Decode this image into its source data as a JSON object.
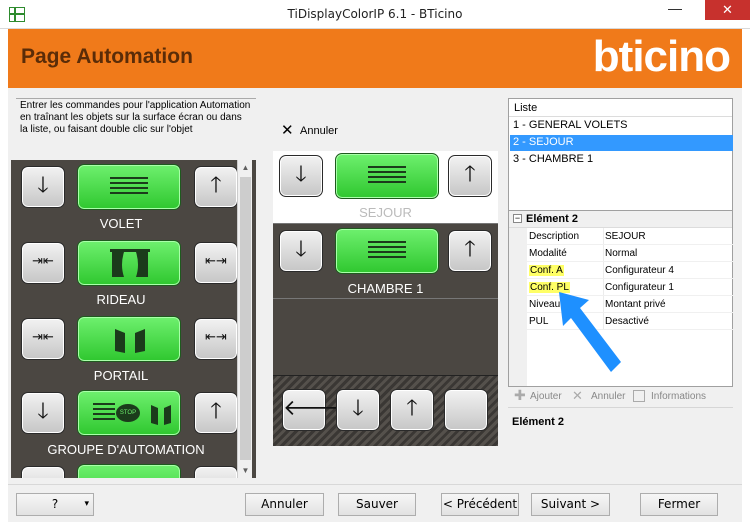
{
  "window": {
    "title": "TiDisplayColorIP 6.1 - BTicino",
    "minimize": "—",
    "maximize": "□",
    "close": "✕"
  },
  "header": {
    "title": "Page Automation",
    "brand": "bticino"
  },
  "instructions": "Entrer les commandes pour l'application Automation en traînant les objets sur la surface écran ou dans la liste, ou faisant double clic sur l'objet",
  "palette": {
    "items": [
      {
        "label": "VOLET",
        "left_icon": "arrow-down-icon",
        "right_icon": "arrow-up-icon"
      },
      {
        "label": "RIDEAU",
        "left_icon": "close-curtain-icon",
        "right_icon": "open-curtain-icon"
      },
      {
        "label": "PORTAIL",
        "left_icon": "close-gate-icon",
        "right_icon": "open-gate-icon"
      },
      {
        "label": "GROUPE D'AUTOMATION",
        "left_icon": "arrow-down-icon",
        "right_icon": "arrow-up-icon"
      }
    ],
    "glyphs": {
      "down": "🡓",
      "up": "🡑",
      "inward": "⇥⇤",
      "outward": "⇤⇥",
      "stop": "STOP"
    }
  },
  "middle": {
    "undo_label": "Annuler",
    "items": [
      {
        "label": "SEJOUR"
      },
      {
        "label": "CHAMBRE 1"
      }
    ],
    "nav_glyphs": {
      "left": "🡐",
      "down": "🡓",
      "up": "🡑",
      "blank": ""
    }
  },
  "list": {
    "header": "Liste",
    "items": [
      {
        "label": "1 - GENERAL VOLETS",
        "selected": false
      },
      {
        "label": "2 - SEJOUR",
        "selected": true
      },
      {
        "label": "3 - CHAMBRE 1",
        "selected": false
      }
    ]
  },
  "properties": {
    "group_toggle": "−",
    "group_title": "Elément 2",
    "rows": [
      {
        "key": "Description",
        "value": "SEJOUR",
        "highlight": false
      },
      {
        "key": "Modalité",
        "value": "Normal",
        "highlight": false
      },
      {
        "key": "Conf. A",
        "value": "Configurateur 4",
        "highlight": true
      },
      {
        "key": "Conf. PL",
        "value": "Configurateur 1",
        "highlight": true
      },
      {
        "key": "Niveau",
        "value": "Montant privé",
        "highlight": false
      },
      {
        "key": "PUL",
        "value": "Desactivé",
        "highlight": false
      }
    ],
    "toolbar": {
      "add": "Ajouter",
      "cancel": "Annuler",
      "info": "Informations"
    },
    "description_title": "Elément 2"
  },
  "bottom": {
    "help": "?",
    "help_arrow": "▾",
    "cancel": "Annuler",
    "save": "Sauver",
    "previous": "< Précédent",
    "next": "Suivant >",
    "close": "Fermer"
  },
  "colors": {
    "accent_orange": "#f07a1a",
    "selection_blue": "#3399ff",
    "annotation_blue": "#1e90ff",
    "highlight_yellow": "#ffff66",
    "button_green": "#3ddb3d"
  }
}
